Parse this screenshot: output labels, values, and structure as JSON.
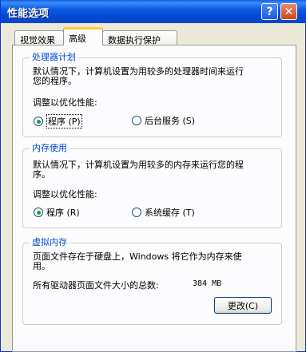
{
  "window": {
    "title": "性能选项"
  },
  "titlebar": {
    "help_glyph": "?",
    "close_glyph": "✕"
  },
  "tabs": [
    {
      "label": "视觉效果",
      "selected": false
    },
    {
      "label": "高级",
      "selected": true
    },
    {
      "label": "数据执行保护",
      "selected": false
    }
  ],
  "processor": {
    "title": "处理器计划",
    "desc_line1": "默认情况下，计算机设置为用较多的处理器时间来运行",
    "desc_line2": "您的程序。",
    "adjust_label": "调整以优化性能:",
    "options": [
      {
        "label": "程序",
        "accel": "(P)",
        "checked": true
      },
      {
        "label": "后台服务",
        "accel": "(S)",
        "checked": false
      }
    ]
  },
  "memory": {
    "title": "内存使用",
    "desc_line1": "默认情况下，计算机设置为用较多的内存来运行您的程",
    "desc_line2": "序。",
    "adjust_label": "调整以优化性能:",
    "options": [
      {
        "label": "程序",
        "accel": "(R)",
        "checked": true
      },
      {
        "label": "系统缓存",
        "accel": "(T)",
        "checked": false
      }
    ]
  },
  "virtual_memory": {
    "title": "虚拟内存",
    "desc_line1": "页面文件存在于硬盘上，Windows 将它作为内存来使",
    "desc_line2": "用。",
    "total_label": "所有驱动器页面文件大小的总数:",
    "total_value": "384 MB",
    "change_button": "更改(C)"
  },
  "colors": {
    "titlebar": "#0348d1",
    "group_title": "#0046d5",
    "face": "#ece9d8",
    "radio_dot": "#21a121"
  }
}
